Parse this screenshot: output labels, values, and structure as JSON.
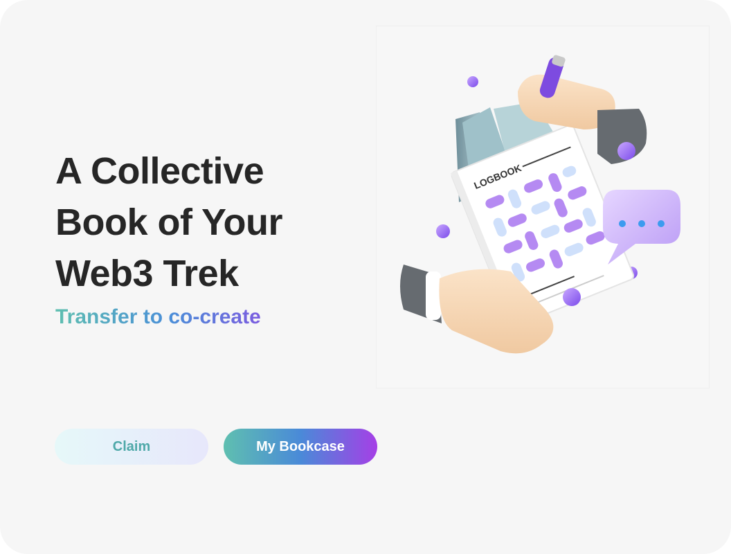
{
  "hero": {
    "headline_lines": [
      "A Collective",
      "Book of Your",
      "Web3 Trek"
    ],
    "subtitle": "Transfer to co-create"
  },
  "actions": {
    "claim_label": "Claim",
    "bookcase_label": "My Bookcase"
  },
  "illustration": {
    "book_label": "LOGBOOK",
    "icon": "logbook-hands-icon"
  },
  "colors": {
    "background": "#f6f6f6",
    "headline": "#262626",
    "gradient_teal": "#5fbfb0",
    "gradient_blue": "#4a8ad8",
    "gradient_purple": "#a53fe6",
    "claim_text": "#4fa9a9"
  }
}
